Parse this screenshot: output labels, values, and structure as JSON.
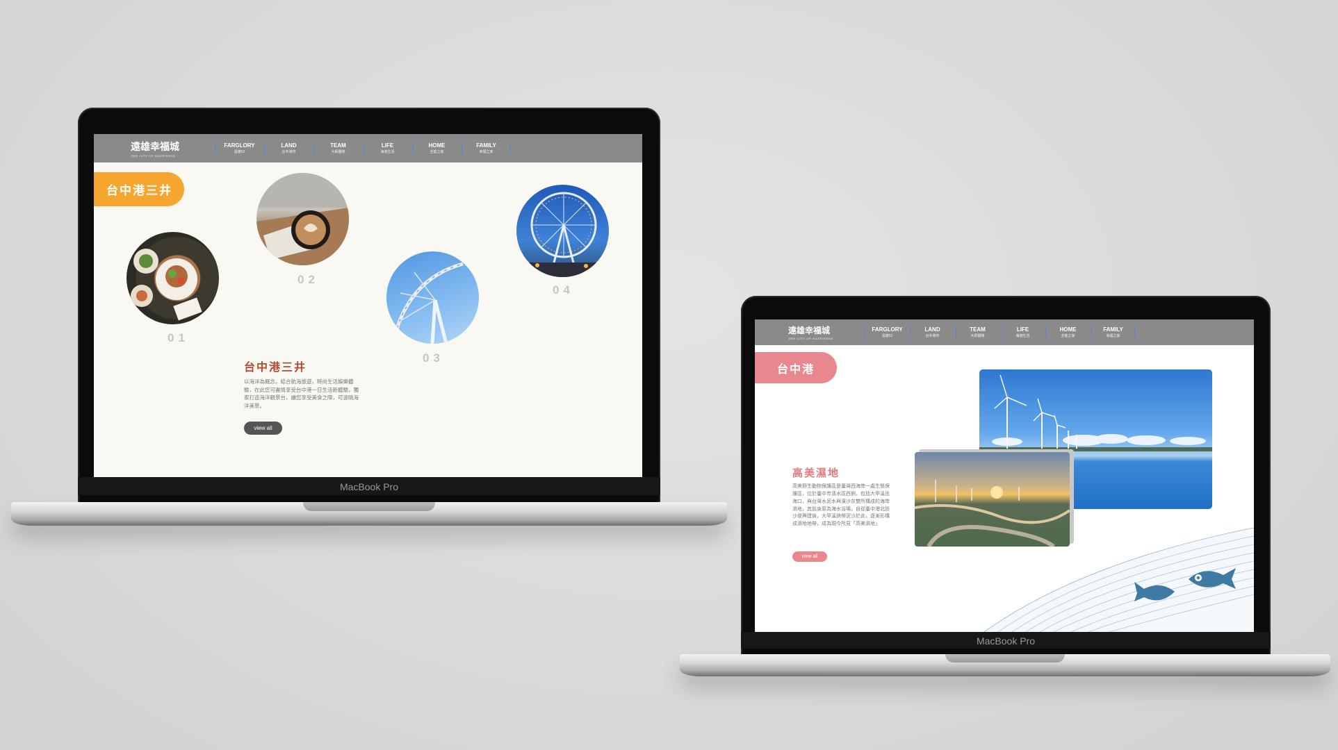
{
  "laptop1": {
    "chin_label": "MacBook Pro",
    "logo": {
      "main": "遠雄幸福城",
      "sub": "THE CITY OF HAPPINESS"
    },
    "nav": [
      {
        "en": "FARGLORY",
        "zh": "遠雄52"
      },
      {
        "en": "LAND",
        "zh": "台中港市"
      },
      {
        "en": "TEAM",
        "zh": "大師團隊"
      },
      {
        "en": "LIFE",
        "zh": "海港生活"
      },
      {
        "en": "HOME",
        "zh": "全能之家"
      },
      {
        "en": "FAMILY",
        "zh": "幸福之家"
      }
    ],
    "pill_label": "台中港三井",
    "numbers": [
      "01",
      "02",
      "03",
      "04"
    ],
    "heading": "台中港三井",
    "paragraph": "以海洋為概念，結合航海旅遊，時尚生活娛樂體驗，在此您可盡情享受台中港一日生活新體驗，獨家打造海洋觀景台，讓您享受美食之際，可遠眺海洋美景。",
    "button": "view all",
    "colors": {
      "accent": "#f6a62f",
      "heading": "#b34a32",
      "bg": "#faf8f3",
      "button": "#555555"
    },
    "images": [
      "food-plate-image",
      "latte-coffee-image",
      "ferris-wheel-sky-image",
      "ferris-wheel-night-image"
    ]
  },
  "laptop2": {
    "chin_label": "MacBook Pro",
    "logo": {
      "main": "遠雄幸福城",
      "sub": "THE CITY OF HAPPINESS"
    },
    "nav": [
      {
        "en": "FARGLORY",
        "zh": "遠雄52"
      },
      {
        "en": "LAND",
        "zh": "台中港市"
      },
      {
        "en": "TEAM",
        "zh": "大師團隊"
      },
      {
        "en": "LIFE",
        "zh": "海港生活"
      },
      {
        "en": "HOME",
        "zh": "全能之家"
      },
      {
        "en": "FAMILY",
        "zh": "幸福之家"
      }
    ],
    "pill_label": "台中港",
    "heading": "高美濕地",
    "paragraph": "高美野生動物保護區是臺灣西海岸一處生態保護區，位於臺中市清水區西側，包括大甲溪出海口，與台灣水泥水與濱沙灰雙所構成的海岸濕地，其前身原為海水浴場，自從臺中港北防沙堤興建後，大甲溪挾帶泥沙於此，逐漸形構成濕地地帶，成為現今所見「高美濕地」",
    "button": "view all",
    "colors": {
      "accent": "#e8888e",
      "heading": "#e07a80",
      "bg": "#ffffff",
      "wave": "#5d8fb0"
    },
    "images": [
      "wind-turbines-sea-image",
      "wetland-sunset-image",
      "fish-icon"
    ]
  }
}
